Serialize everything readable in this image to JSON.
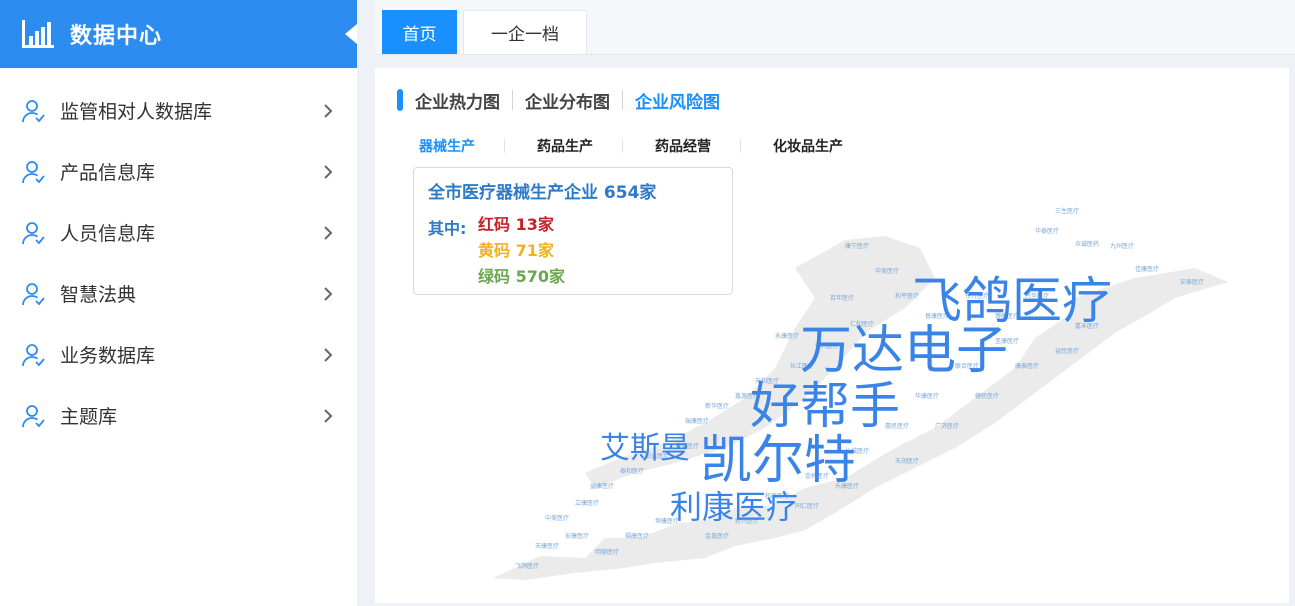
{
  "brand": {
    "title": "数据中心",
    "icon": "bar-chart-icon"
  },
  "sidebar": {
    "items": [
      {
        "label": "监管相对人数据库",
        "icon": "user-icon"
      },
      {
        "label": "产品信息库",
        "icon": "user-icon"
      },
      {
        "label": "人员信息库",
        "icon": "user-icon"
      },
      {
        "label": "智慧法典",
        "icon": "user-icon"
      },
      {
        "label": "业务数据库",
        "icon": "user-icon"
      },
      {
        "label": "主题库",
        "icon": "user-icon"
      }
    ]
  },
  "tabs": [
    {
      "label": "首页",
      "active": true
    },
    {
      "label": "一企一档",
      "active": false
    }
  ],
  "subtabs": [
    {
      "label": "企业热力图",
      "active": false
    },
    {
      "label": "企业分布图",
      "active": false
    },
    {
      "label": "企业风险图",
      "active": true
    }
  ],
  "categories": [
    {
      "label": "器械生产",
      "active": true
    },
    {
      "label": "药品生产",
      "active": false
    },
    {
      "label": "药品经营",
      "active": false
    },
    {
      "label": "化妆品生产",
      "active": false
    }
  ],
  "info": {
    "title_prefix": "全市医疗器械生产企业",
    "total": "654家",
    "label_of": "其中:",
    "red": "红码 13家",
    "yellow": "黄码 71家",
    "green": "绿码 570家"
  },
  "wordcloud": {
    "words": [
      "飞鸽医疗",
      "万达电子",
      "好帮手",
      "凯尔特",
      "艾斯曼",
      "利康医疗"
    ]
  },
  "colors": {
    "accent": "#1890ff",
    "brand": "#2d8cf0",
    "red": "#c8202a",
    "yellow": "#f2b022",
    "green": "#6aa84f",
    "cloud_word": "#3a84e8"
  }
}
